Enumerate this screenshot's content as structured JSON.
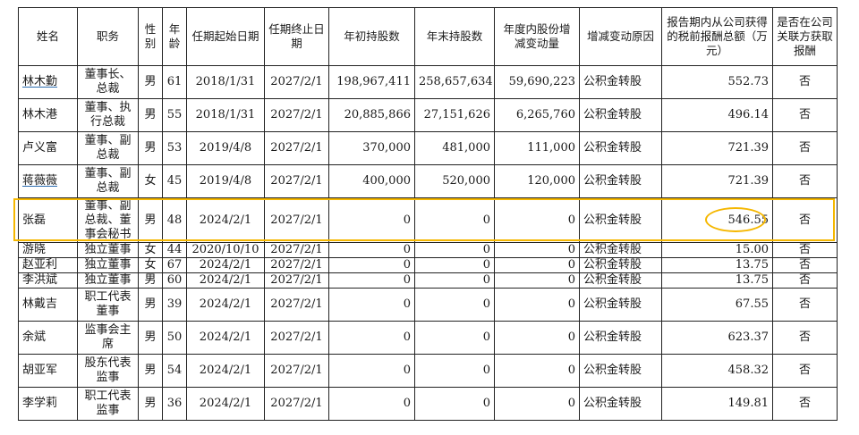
{
  "headers": {
    "name": "姓名",
    "position": "职务",
    "gender": "性别",
    "age": "年龄",
    "term_start": "任期起始日期",
    "term_end": "任期终止日期",
    "shares_begin": "年初持股数",
    "shares_end": "年末持股数",
    "shares_change": "年度内股份增减变动量",
    "change_reason": "增减变动原因",
    "compensation": "报告期内从公司获得的税前报酬总额（万元）",
    "related_party_pay": "是否在公司关联方获取报酬"
  },
  "rows": [
    {
      "name": "林木勤",
      "position": "董事长、总裁",
      "gender": "男",
      "age": "61",
      "start": "2018/1/31",
      "end": "2027/2/1",
      "shares_begin": "198,967,411",
      "shares_end": "258,657,634",
      "change": "59,690,223",
      "reason": "公积金转股",
      "comp": "552.73",
      "related": "否"
    },
    {
      "name": "林木港",
      "position": "董事、执行总裁",
      "gender": "男",
      "age": "55",
      "start": "2018/1/31",
      "end": "2027/2/1",
      "shares_begin": "20,885,866",
      "shares_end": "27,151,626",
      "change": "6,265,760",
      "reason": "公积金转股",
      "comp": "496.14",
      "related": "否"
    },
    {
      "name": "卢义富",
      "position": "董事、副总裁",
      "gender": "男",
      "age": "53",
      "start": "2019/4/8",
      "end": "2027/2/1",
      "shares_begin": "370,000",
      "shares_end": "481,000",
      "change": "111,000",
      "reason": "公积金转股",
      "comp": "721.39",
      "related": "否"
    },
    {
      "name": "蒋薇薇",
      "position": "董事、副总裁",
      "gender": "女",
      "age": "45",
      "start": "2019/4/8",
      "end": "2027/2/1",
      "shares_begin": "400,000",
      "shares_end": "520,000",
      "change": "120,000",
      "reason": "公积金转股",
      "comp": "721.39",
      "related": "否"
    },
    {
      "name": "张磊",
      "position": "董事、副总裁、董事会秘书",
      "gender": "男",
      "age": "48",
      "start": "2024/2/1",
      "end": "2027/2/1",
      "shares_begin": "0",
      "shares_end": "0",
      "change": "0",
      "reason": "公积金转股",
      "comp": "546.55",
      "related": "否"
    },
    {
      "name": "游晓",
      "position": "独立董事",
      "gender": "女",
      "age": "44",
      "start": "2020/10/10",
      "end": "2027/2/1",
      "shares_begin": "0",
      "shares_end": "0",
      "change": "0",
      "reason": "公积金转股",
      "comp": "15.00",
      "related": "否"
    },
    {
      "name": "赵亚利",
      "position": "独立董事",
      "gender": "女",
      "age": "67",
      "start": "2024/2/1",
      "end": "2027/2/1",
      "shares_begin": "0",
      "shares_end": "0",
      "change": "0",
      "reason": "公积金转股",
      "comp": "13.75",
      "related": "否"
    },
    {
      "name": "李洪斌",
      "position": "独立董事",
      "gender": "男",
      "age": "60",
      "start": "2024/2/1",
      "end": "2027/2/1",
      "shares_begin": "0",
      "shares_end": "0",
      "change": "0",
      "reason": "公积金转股",
      "comp": "13.75",
      "related": "否"
    },
    {
      "name": "林戴吉",
      "position": "职工代表董事",
      "gender": "男",
      "age": "39",
      "start": "2024/2/1",
      "end": "2027/2/1",
      "shares_begin": "0",
      "shares_end": "0",
      "change": "0",
      "reason": "公积金转股",
      "comp": "67.55",
      "related": "否"
    },
    {
      "name": "余斌",
      "position": "监事会主席",
      "gender": "男",
      "age": "50",
      "start": "2024/2/1",
      "end": "2027/2/1",
      "shares_begin": "0",
      "shares_end": "0",
      "change": "0",
      "reason": "公积金转股",
      "comp": "623.37",
      "related": "否"
    },
    {
      "name": "胡亚军",
      "position": "股东代表监事",
      "gender": "男",
      "age": "54",
      "start": "2024/2/1",
      "end": "2027/2/1",
      "shares_begin": "0",
      "shares_end": "0",
      "change": "0",
      "reason": "公积金转股",
      "comp": "458.32",
      "related": "否"
    },
    {
      "name": "李学莉",
      "position": "职工代表监事",
      "gender": "男",
      "age": "36",
      "start": "2024/2/1",
      "end": "2027/2/1",
      "shares_begin": "0",
      "shares_end": "0",
      "change": "0",
      "reason": "公积金转股",
      "comp": "149.81",
      "related": "否"
    }
  ],
  "highlight": {
    "row_name": "张磊",
    "circled_value": "546.55",
    "color": "#f5b700"
  }
}
